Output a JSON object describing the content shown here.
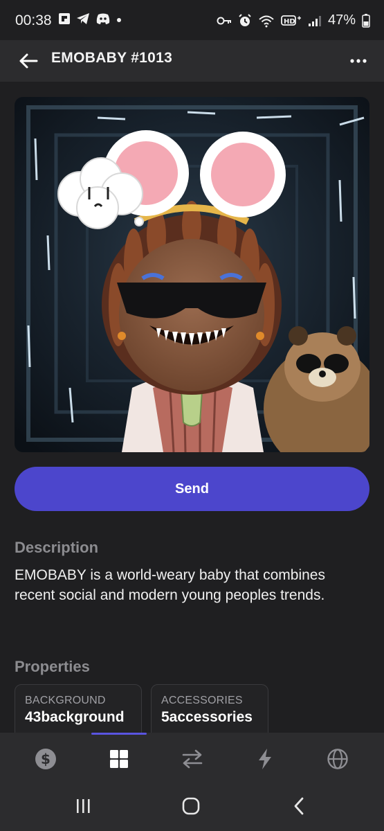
{
  "status_bar": {
    "time": "00:38",
    "battery": "47%",
    "left_icons": [
      "flipboard-icon",
      "telegram-icon",
      "discord-icon",
      "dot-icon"
    ],
    "right_icons": [
      "vpn-key-icon",
      "alarm-icon",
      "wifi-icon",
      "hd-signal-icon",
      "cell-signal-icon",
      "battery-icon"
    ]
  },
  "app_bar": {
    "title": "EMOBABY #1013",
    "back_icon": "arrow-left-icon",
    "more_icon": "more-dots-icon"
  },
  "nft": {
    "image_name": "nft-artwork"
  },
  "actions": {
    "send_label": "Send"
  },
  "description": {
    "heading": "Description",
    "text": "EMOBABY is a world-weary baby that combines recent social and modern young peoples trends."
  },
  "properties": {
    "heading": "Properties",
    "items": [
      {
        "key": "BACKGROUND",
        "value": "43background"
      },
      {
        "key": "ACCESSORIES",
        "value": "5accessories"
      }
    ]
  },
  "bottom_nav": {
    "items": [
      {
        "icon": "dollar-icon"
      },
      {
        "icon": "grid-icon",
        "active": true
      },
      {
        "icon": "swap-icon"
      },
      {
        "icon": "lightning-icon"
      },
      {
        "icon": "globe-icon"
      }
    ]
  },
  "colors": {
    "background": "#1f1f21",
    "app_bar": "#2c2c2e",
    "accent": "#4c46cc",
    "muted_text": "#8c8c90"
  }
}
